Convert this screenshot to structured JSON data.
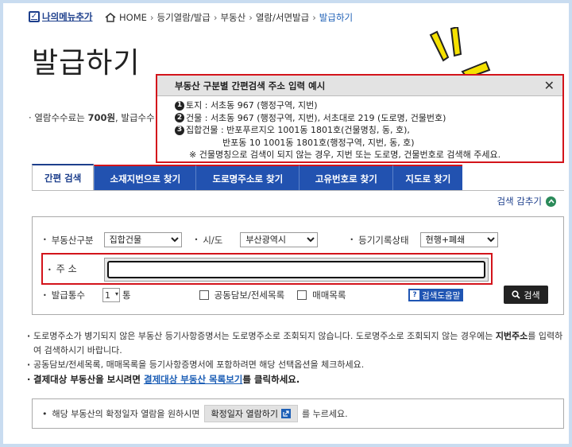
{
  "header": {
    "my_menu_label": "나의메뉴추가",
    "breadcrumb": [
      "HOME",
      "등기열람/발급",
      "부동산",
      "열람/서면발급",
      "발급하기"
    ]
  },
  "page_title": "발급하기",
  "fee_text_prefix": "열람수수료는 ",
  "fee_text_bold": "700원",
  "fee_text_suffix": ", 발급수수",
  "popup": {
    "title": "부동산 구분별 간편검색 주소 입력 예시",
    "lines": [
      {
        "num": "1",
        "text": "토지 : 서초동 967 (행정구역, 지번)"
      },
      {
        "num": "2",
        "text": "건물 : 서초동 967 (행정구역, 지번), 서초대로 219 (도로명, 건물번호)"
      },
      {
        "num": "3",
        "text": "집합건물 : 반포푸르지오 1001동 1801호(건물명칭, 동, 호),"
      }
    ],
    "line3_cont": "반포동 10 1001동 1801호(행정구역, 지번, 동, 호)",
    "note": "※ 건물명칭으로 검색이 되지 않는 경우, 지번 또는 도로명, 건물번호로 검색해 주세요."
  },
  "tabs": [
    "간편 검색",
    "소재지번으로 찾기",
    "도로명주소로 찾기",
    "고유번호로 찾기",
    "지도로 찾기"
  ],
  "collapse_label": "검색 감추기",
  "search": {
    "type_label": "부동산구분",
    "type_value": "집합건물",
    "region_label": "시/도",
    "region_value": "부산광역시",
    "status_label": "등기기록상태",
    "status_value": "현행+폐쇄",
    "address_label": "주 소",
    "address_value": "",
    "count_label": "발급통수",
    "count_value": "1",
    "count_unit": "통",
    "option1": "공동담보/전세목록",
    "option2": "매매목록",
    "help_label": "검색도움말",
    "search_button": "검색"
  },
  "notes": {
    "n1_a": "도로명주소가 병기되지 않은 부동산 등기사항증명서는 도로명주소로 조회되지 않습니다. 도로명주소로 조회되지 않는 경우에는 ",
    "n1_b": "지번주소",
    "n1_c": "를 입력하여 검색하시기 바랍니다.",
    "n2": "공동담보/전세목록, 매매목록을 등기사항증명서에 포함하려면 해당 선택옵션을 체크하세요.",
    "n3_a": "결제대상 부동산을 보시려면 ",
    "n3_link": "결제대상 부동산 목록보기",
    "n3_b": "를 클릭하세요."
  },
  "notice": {
    "prefix": "해당 부동산의 확정일자 열람을 원하시면",
    "button": "확정일자 열람하기",
    "suffix": "를 누르세요."
  },
  "colors": {
    "accent_red": "#d3141b",
    "tab_blue": "#2252b0",
    "sparkle_yellow": "#f5e100"
  }
}
